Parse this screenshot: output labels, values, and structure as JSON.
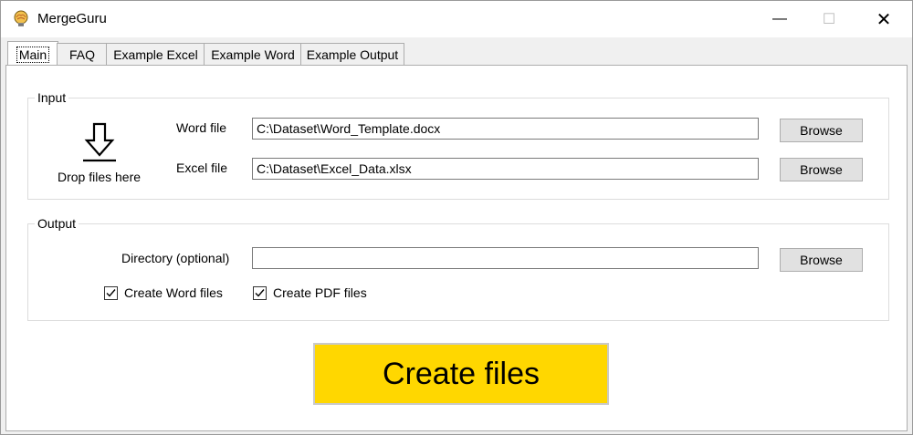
{
  "window": {
    "title": "MergeGuru",
    "app_icon": "brain-bulb-icon"
  },
  "controls": {
    "minimize": "—",
    "maximize": "☐",
    "close": "✕"
  },
  "tabs": [
    {
      "label": "Main",
      "active": true
    },
    {
      "label": "FAQ"
    },
    {
      "label": "Example Excel"
    },
    {
      "label": "Example Word"
    },
    {
      "label": "Example Output"
    }
  ],
  "input": {
    "group_label": "Input",
    "drop_label": "Drop files here",
    "drop_icon": "download-arrow-icon",
    "word_label": "Word file",
    "word_value": "C:\\Dataset\\Word_Template.docx",
    "excel_label": "Excel file",
    "excel_value": "C:\\Dataset\\Excel_Data.xlsx",
    "browse_label": "Browse"
  },
  "output": {
    "group_label": "Output",
    "directory_label": "Directory (optional)",
    "directory_value": "",
    "browse_label": "Browse",
    "create_word_label": "Create Word files",
    "create_word_checked": true,
    "create_pdf_label": "Create PDF files",
    "create_pdf_checked": true
  },
  "action": {
    "create_label": "Create files",
    "color": "#ffd700"
  }
}
